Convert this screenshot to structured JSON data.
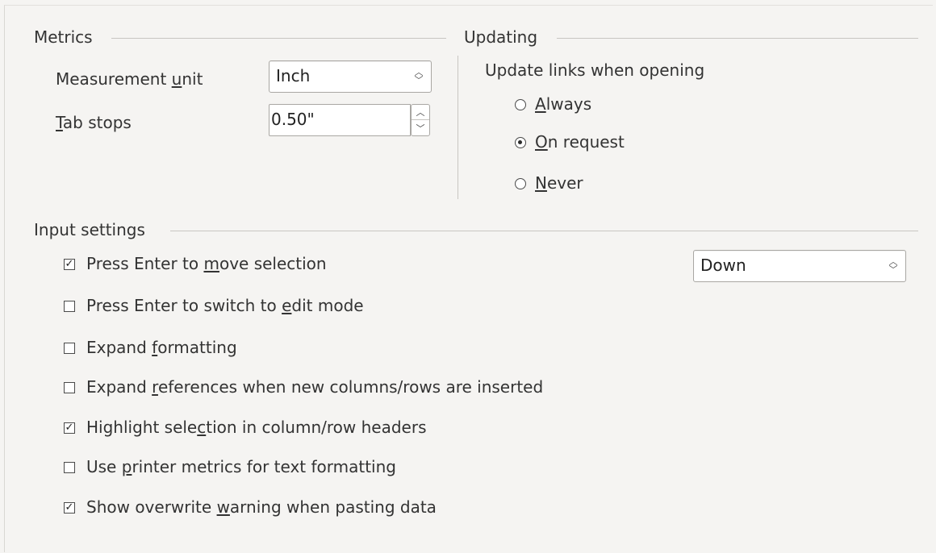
{
  "metrics": {
    "title": "Metrics",
    "measurement_unit": {
      "label_pre": "Measurement ",
      "label_u": "u",
      "label_post": "nit",
      "value": "Inch"
    },
    "tab_stops": {
      "label_pre": "",
      "label_u": "T",
      "label_post": "ab stops",
      "value": "0.50\""
    }
  },
  "updating": {
    "title": "Updating",
    "subtitle": "Update links when opening",
    "options": [
      {
        "pre": "",
        "u": "A",
        "post": "lways",
        "selected": false
      },
      {
        "pre": "",
        "u": "O",
        "post": "n request",
        "selected": true
      },
      {
        "pre": "",
        "u": "N",
        "post": "ever",
        "selected": false
      }
    ]
  },
  "input_settings": {
    "title": "Input settings",
    "direction_value": "Down",
    "options": [
      {
        "pre": "Press Enter to ",
        "u": "m",
        "post": "ove selection",
        "checked": true
      },
      {
        "pre": "Press Enter to switch to ",
        "u": "e",
        "post": "dit mode",
        "checked": false
      },
      {
        "pre": "Expand ",
        "u": "f",
        "post": "ormatting",
        "checked": false
      },
      {
        "pre": "Expand ",
        "u": "r",
        "post": "eferences when new columns/rows are inserted",
        "checked": false
      },
      {
        "pre": "Highlight sele",
        "u": "c",
        "post": "tion in column/row headers",
        "checked": true
      },
      {
        "pre": "Use ",
        "u": "p",
        "post": "rinter metrics for text formatting",
        "checked": false
      },
      {
        "pre": "Show overwrite ",
        "u": "w",
        "post": "arning when pasting data",
        "checked": true
      }
    ]
  },
  "glyphs": {
    "check": "✓",
    "up": "⌃",
    "down": "⌄"
  }
}
